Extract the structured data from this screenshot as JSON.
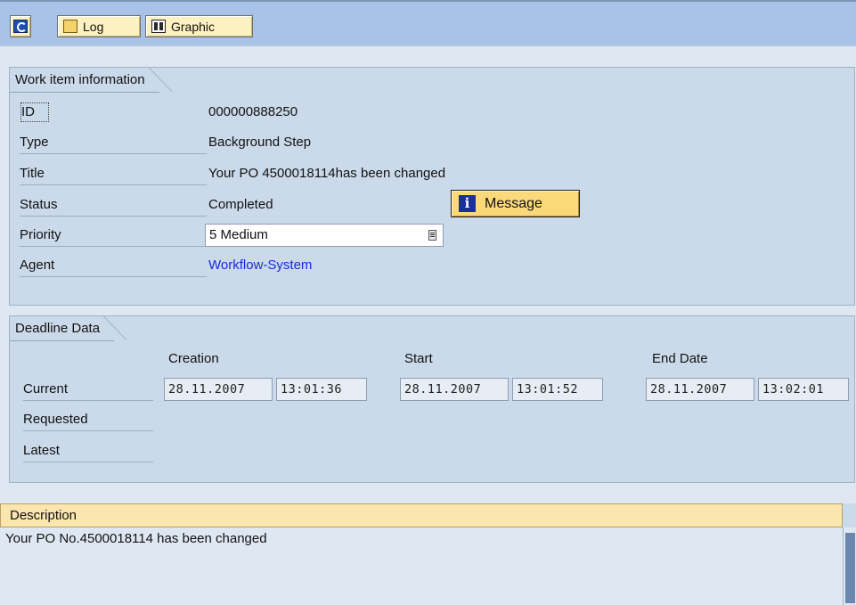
{
  "toolbar": {
    "log_label": "Log",
    "graphic_label": "Graphic"
  },
  "workitem": {
    "title": "Work item information",
    "id_label": "ID",
    "id_value": "000000888250",
    "type_label": "Type",
    "type_value": "Background Step",
    "title_label": "Title",
    "title_value": "Your PO 4500018114has been changed",
    "status_label": "Status",
    "status_value": "Completed",
    "message_label": "Message",
    "priority_label": "Priority",
    "priority_value": "5 Medium",
    "agent_label": "Agent",
    "agent_value": "Workflow-System"
  },
  "deadline": {
    "title": "Deadline Data",
    "col_creation": "Creation",
    "col_start": "Start",
    "col_end": "End Date",
    "row_current": "Current",
    "row_requested": "Requested",
    "row_latest": "Latest",
    "creation_date": "28.11.2007",
    "creation_time": "13:01:36",
    "start_date": "28.11.2007",
    "start_time": "13:01:52",
    "end_date": "28.11.2007",
    "end_time": "13:02:01"
  },
  "description": {
    "title": "Description",
    "text": "Your PO No.4500018114 has been changed"
  },
  "icons": {
    "refresh": "refresh-icon",
    "log": "log-icon",
    "graphic": "graphic-icon",
    "message": "info-icon"
  },
  "colors": {
    "toolbar": "#a9c3e8",
    "group": "#cbdaea",
    "button": "#fcf1c0",
    "link": "#1a2ae0"
  }
}
